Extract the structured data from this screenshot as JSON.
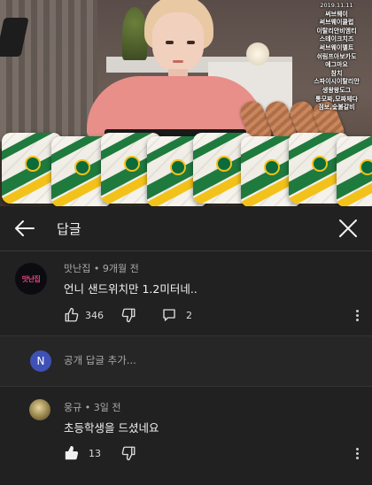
{
  "video": {
    "menu_overlay": {
      "date": "2019.11.11",
      "lines": [
        "써브웨이",
        "써브웨이클럽",
        "이탈리안비엠티",
        "스테이크치즈",
        "써브웨이멜트",
        "쉬림프아보카도",
        "에그마요",
        "참치",
        "스파이시이탈리안",
        "생왕왕도그",
        "통모짜,모짜체다",
        "점보,숯불갈비"
      ]
    }
  },
  "header": {
    "title": "답글",
    "back_icon": "arrow-left-icon",
    "close_icon": "close-icon"
  },
  "parent_comment": {
    "author": "맛난집",
    "time": "9개월 전",
    "meta": "맛난집 • 9개월 전",
    "avatar_text": "맛난집",
    "text": "언니 샌드위치만 1.2미터네..",
    "likes": "346",
    "replies": "2"
  },
  "add_reply": {
    "avatar_letter": "N",
    "placeholder": "공개 답글 추가..."
  },
  "reply_comment": {
    "author": "웅규",
    "time": "3일 전",
    "meta": "웅규 • 3일 전",
    "text": "초등학생을 드셨네요",
    "likes": "13"
  },
  "colors": {
    "background": "#212121",
    "text": "#f1f1f1",
    "muted": "#aaaaaa",
    "user_avatar": "#3f51b5"
  }
}
